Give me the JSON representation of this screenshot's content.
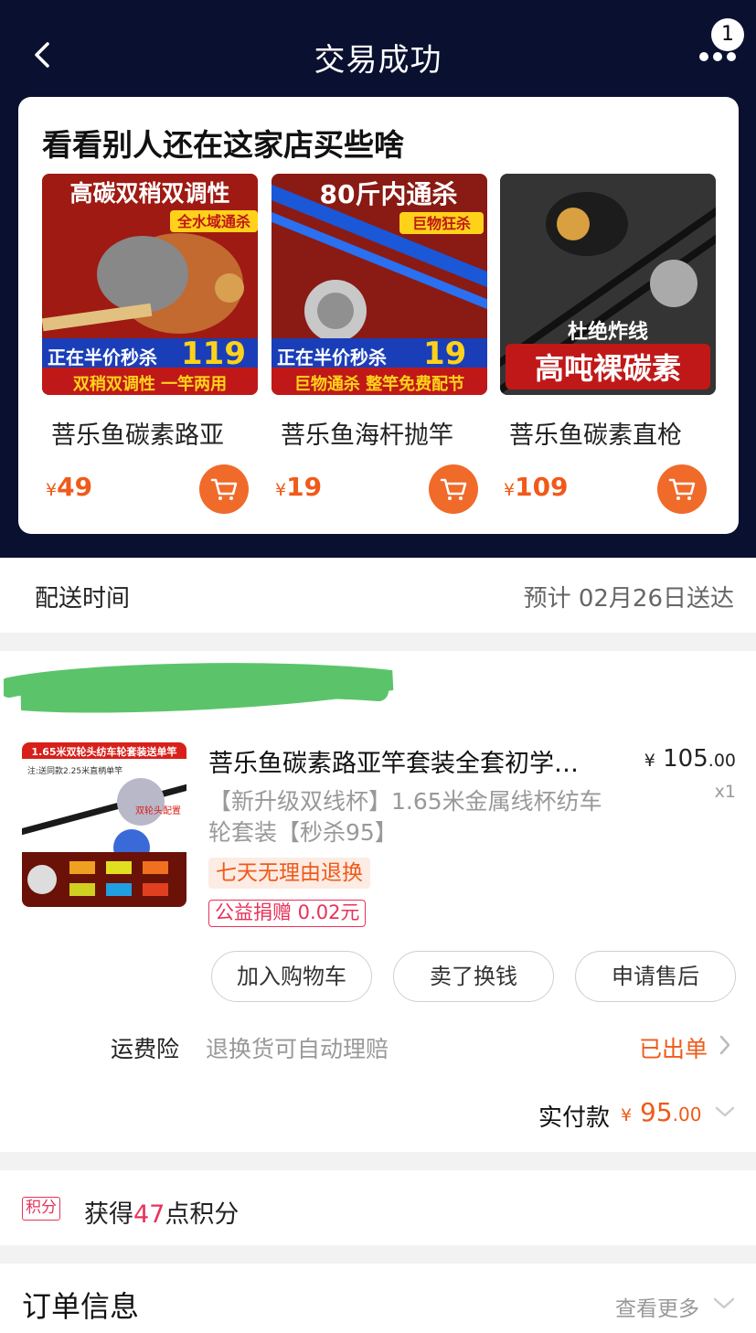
{
  "nav": {
    "title": "交易成功",
    "badge_count": "1"
  },
  "recommend": {
    "title": "看看别人还在这家店买些啥",
    "items": [
      {
        "name": "菩乐鱼碳素路亚",
        "currency": "¥",
        "price": "49",
        "banner_top": "高碳双稍双调性",
        "tag": "全水域通杀",
        "promo": "正在半价秒杀",
        "promo_price": "119",
        "promo_sub": "双稍双调性 一竿两用"
      },
      {
        "name": "菩乐鱼海杆抛竿",
        "currency": "¥",
        "price": "19",
        "banner_top": "80斤内通杀",
        "tag": "巨物狂杀",
        "promo": "正在半价秒杀",
        "promo_price": "19",
        "promo_sub": "巨物通杀 整竿免费配节"
      },
      {
        "name": "菩乐鱼碳素直枪",
        "currency": "¥",
        "price": "109",
        "banner_top": "杜绝炸线",
        "promo_sub": "高吨裸碳素"
      }
    ]
  },
  "delivery": {
    "label": "配送时间",
    "value": "预计 02月26日送达"
  },
  "order_item": {
    "title": "菩乐鱼碳素路亚竿套装全套初学…",
    "sku": "【新升级双线杯】1.65米金属线杯纺车轮套装【秒杀95】",
    "currency": "¥",
    "price_int": "105",
    "price_dec": ".00",
    "qty": "x1",
    "tag_return": "七天无理由退换",
    "tag_charity": "公益捐赠 0.02元",
    "thumb_banner": "1.65米双轮头纺车轮套装送单竿",
    "thumb_note": "注:送同款2.25米直柄单竿",
    "thumb_tag": "双轮头配置"
  },
  "actions": {
    "add_cart": "加入购物车",
    "resell": "卖了换钱",
    "after_sale": "申请售后"
  },
  "shipping_insurance": {
    "label": "运费险",
    "desc": "退换货可自动理赔",
    "status": "已出单"
  },
  "payment": {
    "label": "实付款",
    "currency": "¥",
    "amount_int": "95",
    "amount_dec": ".00"
  },
  "points": {
    "tag": "积分",
    "prefix": "获得",
    "count": "47",
    "suffix": "点积分"
  },
  "order_info": {
    "title": "订单信息",
    "more": "查看更多"
  },
  "colors": {
    "header_bg": "#0a1030",
    "accent": "#f05a1a",
    "red": "#e8325a"
  }
}
